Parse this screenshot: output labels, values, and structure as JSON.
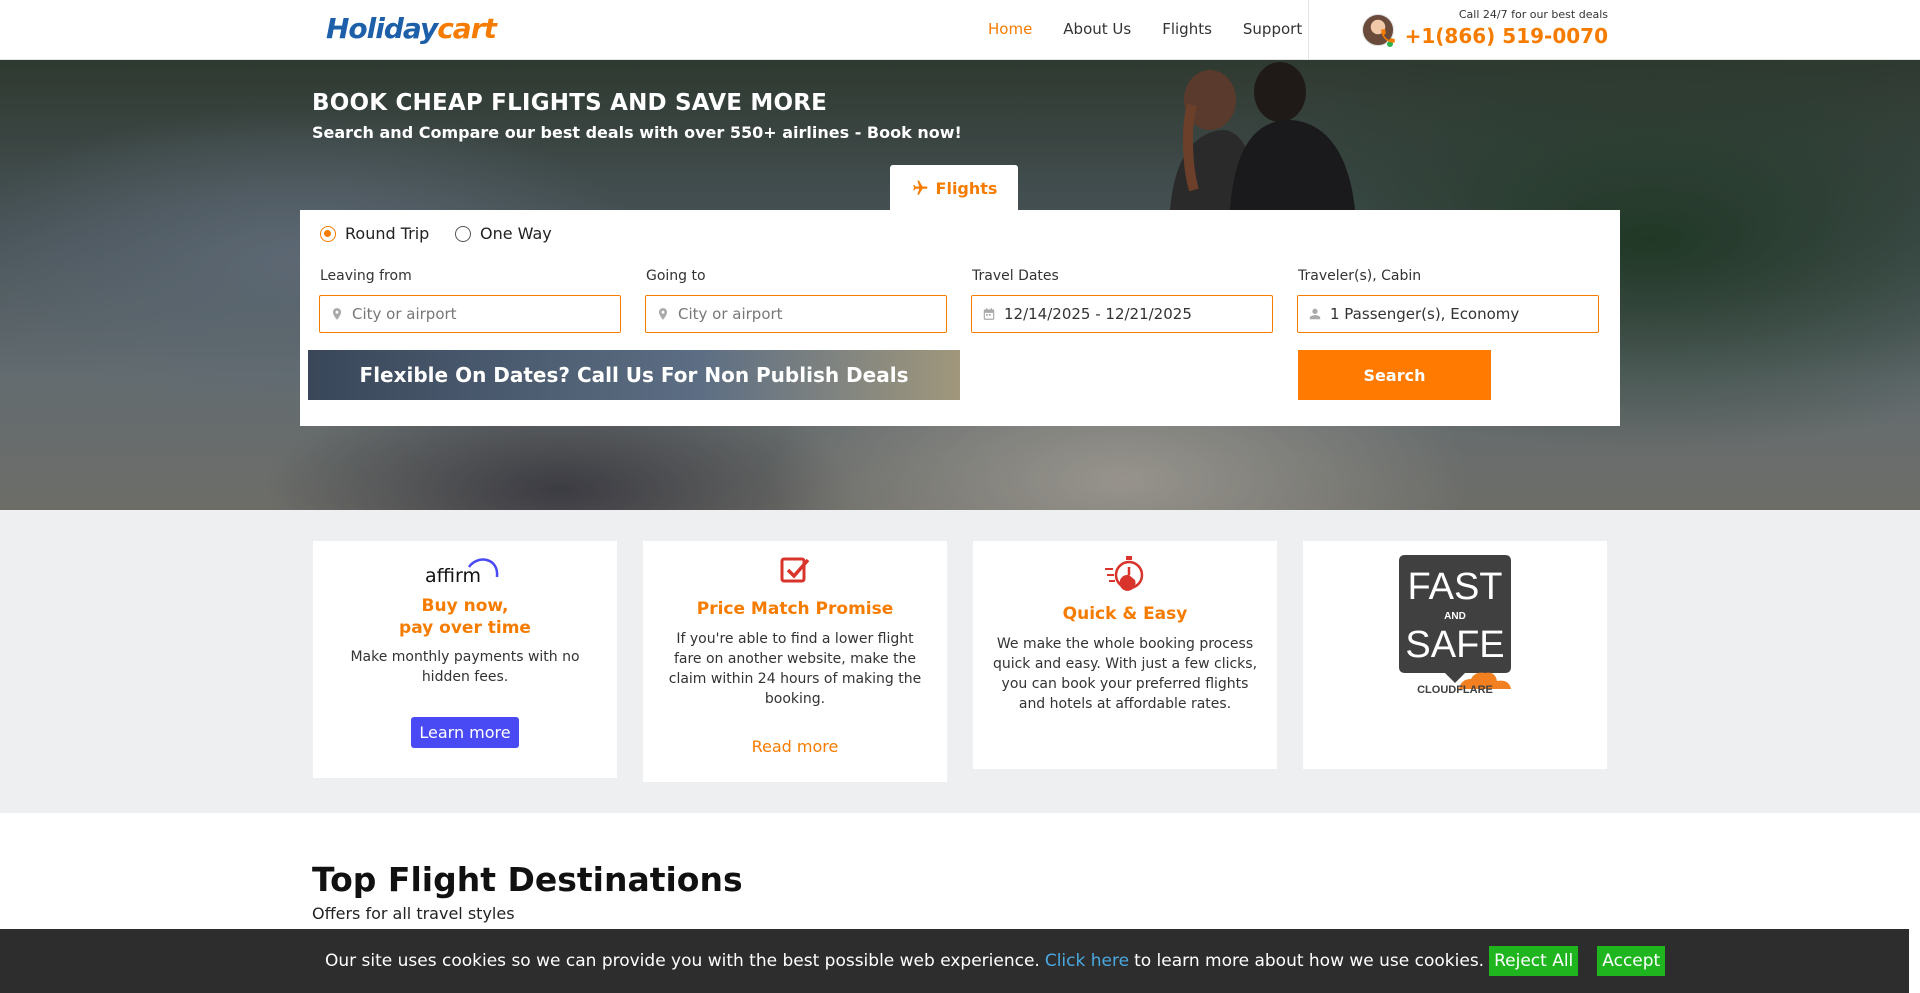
{
  "brand": {
    "logo_part1": "Holiday",
    "logo_part2": "cart"
  },
  "nav": {
    "items": [
      {
        "label": "Home",
        "active": true
      },
      {
        "label": "About Us"
      },
      {
        "label": "Flights"
      },
      {
        "label": "Support"
      }
    ]
  },
  "contact": {
    "caption": "Call 24/7 for our best deals",
    "phone": "+1(866) 519-0070"
  },
  "hero": {
    "title": "BOOK CHEAP FLIGHTS AND SAVE MORE",
    "subtitle": "Search and Compare our best deals with over 550+ airlines - Book now!"
  },
  "search": {
    "tab_label": "Flights",
    "trip_types": [
      {
        "label": "Round Trip",
        "selected": true
      },
      {
        "label": "One Way",
        "selected": false
      }
    ],
    "fields": {
      "from": {
        "label": "Leaving from",
        "placeholder": "City or airport",
        "value": ""
      },
      "to": {
        "label": "Going to",
        "placeholder": "City or airport",
        "value": ""
      },
      "dates": {
        "label": "Travel Dates",
        "value": "12/14/2025 - 12/21/2025"
      },
      "travelers": {
        "label": "Traveler(s), Cabin",
        "value": "1 Passenger(s), Economy"
      }
    },
    "flex_banner": "Flexible On Dates? Call Us For Non Publish Deals",
    "search_button": "Search"
  },
  "features": [
    {
      "logo_text": "affirm",
      "title_line1": "Buy now,",
      "title_line2": "pay over time",
      "text": "Make monthly payments with no hidden fees.",
      "cta": "Learn more"
    },
    {
      "title": "Price Match Promise",
      "text": "If you're able to find a lower flight fare on another website, make the claim within 24 hours of making the booking.",
      "cta": "Read more"
    },
    {
      "title": "Quick & Easy",
      "text": "We make the whole booking process quick and easy. With just a few clicks, you can book your preferred flights and hotels at affordable rates."
    },
    {
      "badge_line1": "FAST",
      "badge_and": "AND",
      "badge_line2": "SAFE",
      "badge_brand": "CLOUDFLARE"
    }
  ],
  "destinations": {
    "title": "Top Flight Destinations",
    "subtitle": "Offers for all travel styles"
  },
  "cookie": {
    "text_before": "Our site uses cookies so we can provide you with the best possible web experience.",
    "link": "Click here",
    "text_after": "to learn more about how we use cookies.",
    "reject": "Reject All",
    "accept": "Accept"
  },
  "colors": {
    "accent": "#f57c00",
    "brand_blue": "#1d5fa8",
    "affirm_blue": "#4a4af4",
    "cookie_green": "#1fb51f"
  }
}
